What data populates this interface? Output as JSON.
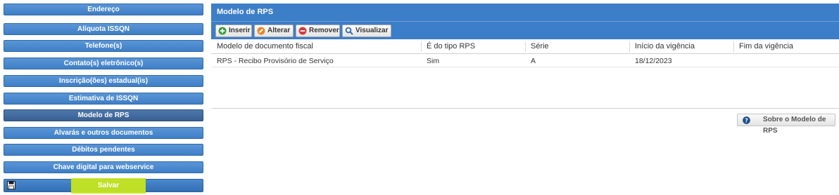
{
  "nav": {
    "items": [
      {
        "label": "Endereço",
        "active": false
      },
      {
        "label": "Alíquota ISSQN",
        "active": false
      },
      {
        "label": "Telefone(s)",
        "active": false
      },
      {
        "label": "Contato(s) eletrônico(s)",
        "active": false
      },
      {
        "label": "Inscrição(ões) estadual(is)",
        "active": false
      },
      {
        "label": "Estimativa de ISSQN",
        "active": false
      },
      {
        "label": "Modelo de RPS",
        "active": true
      },
      {
        "label": "Alvarás e outros documentos",
        "active": false
      },
      {
        "label": "Débitos pendentes",
        "active": false
      },
      {
        "label": "Chave digital para webservice",
        "active": false
      }
    ],
    "save_label": "Salvar",
    "save_icon": "floppy-disk-icon"
  },
  "panel": {
    "title": "Modelo de RPS",
    "toolbar": {
      "insert_label": "Inserir",
      "edit_label": "Alterar",
      "remove_label": "Remover",
      "view_label": "Visualizar"
    },
    "table": {
      "columns": [
        "Modelo de documento fiscal",
        "É do tipo RPS",
        "Série",
        "Início da vigência",
        "Fim da vigência"
      ],
      "rows": [
        [
          "RPS - Recibo Provisório de Serviço",
          "Sim",
          "A",
          "18/12/2023",
          ""
        ]
      ]
    },
    "about_label": "Sobre o Modelo de RPS"
  },
  "colors": {
    "nav_button": "#3f7fc6",
    "panel_header": "#3d7ec8",
    "highlight": "#c9e81a"
  }
}
